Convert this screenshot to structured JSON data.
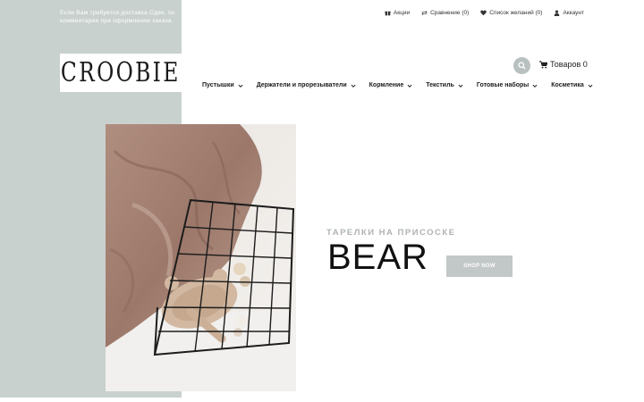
{
  "notice": {
    "line1": "Если Вам требуется доставка Сдек, по",
    "line2": "комментарии при оформлении заказа"
  },
  "topbar": {
    "items": [
      {
        "label": "Акции",
        "icon": "gift-icon"
      },
      {
        "label": "Сравнение (0)",
        "icon": "compare-icon"
      },
      {
        "label": "Список желаний (0)",
        "icon": "heart-icon"
      },
      {
        "label": "Аккаунт",
        "icon": "user-icon"
      }
    ]
  },
  "logo": {
    "text": "CROOBIE"
  },
  "header": {
    "search_icon": "search-icon",
    "cart_label": "Товаров 0",
    "cart_icon": "cart-icon"
  },
  "nav": {
    "items": [
      {
        "label": "Пустышки"
      },
      {
        "label": "Держатели и прорезыватели"
      },
      {
        "label": "Кормление"
      },
      {
        "label": "Текстиль"
      },
      {
        "label": "Готовые наборы"
      },
      {
        "label": "Косметика"
      }
    ]
  },
  "hero": {
    "subtitle": "ТАРЕЛКИ НА ПРИСОСКЕ",
    "title": "BEAR",
    "button_label": "SHOP NOW"
  },
  "colors": {
    "side_panel": "#c9d1cf",
    "button": "#c2c7c7",
    "subtitle": "#aeb3b3"
  }
}
